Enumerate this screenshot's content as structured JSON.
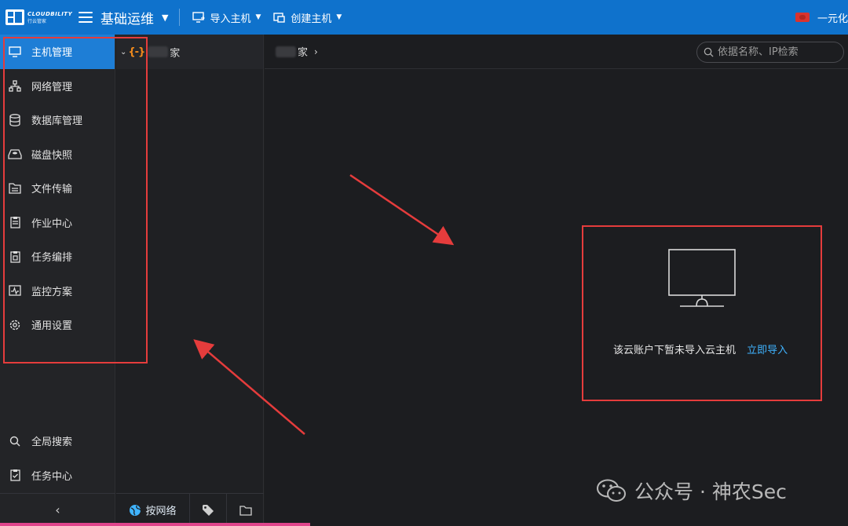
{
  "topbar": {
    "logo_main": "CLOUDBILITY",
    "logo_sub": "行云管家",
    "app_title": "基础运维",
    "actions": [
      {
        "label": "导入主机",
        "icon": "import-host-icon"
      },
      {
        "label": "创建主机",
        "icon": "create-host-icon"
      }
    ],
    "right_label": "一元化"
  },
  "sidebar": {
    "items": [
      {
        "label": "主机管理",
        "icon": "monitor-icon",
        "active": true
      },
      {
        "label": "网络管理",
        "icon": "network-icon"
      },
      {
        "label": "数据库管理",
        "icon": "database-icon"
      },
      {
        "label": "磁盘快照",
        "icon": "disk-icon"
      },
      {
        "label": "文件传输",
        "icon": "file-transfer-icon"
      },
      {
        "label": "作业中心",
        "icon": "clipboard-icon"
      },
      {
        "label": "任务编排",
        "icon": "task-icon"
      },
      {
        "label": "监控方案",
        "icon": "monitor-wave-icon"
      },
      {
        "label": "通用设置",
        "icon": "gear-icon"
      }
    ],
    "bottom_items": [
      {
        "label": "全局搜索",
        "icon": "search-icon"
      },
      {
        "label": "任务中心",
        "icon": "task-check-icon"
      }
    ],
    "collapse": "‹"
  },
  "tree": {
    "node_icon": "{-}",
    "node_label": "家",
    "tabs": [
      {
        "label": "按网络",
        "icon": "globe-icon"
      },
      {
        "label": "",
        "icon": "tag-icon"
      },
      {
        "label": "",
        "icon": "folder-icon"
      }
    ]
  },
  "main": {
    "breadcrumb": "家",
    "search_placeholder": "依据名称、IP检索",
    "empty_message": "该云账户下暂未导入云主机",
    "empty_action": "立即导入"
  },
  "watermark": {
    "text": "公众号 · 神农Sec"
  },
  "colors": {
    "topbar": "#0f72cc",
    "active": "#1e7ed6",
    "annotation": "#e53c3c",
    "link": "#3fb3ff"
  }
}
